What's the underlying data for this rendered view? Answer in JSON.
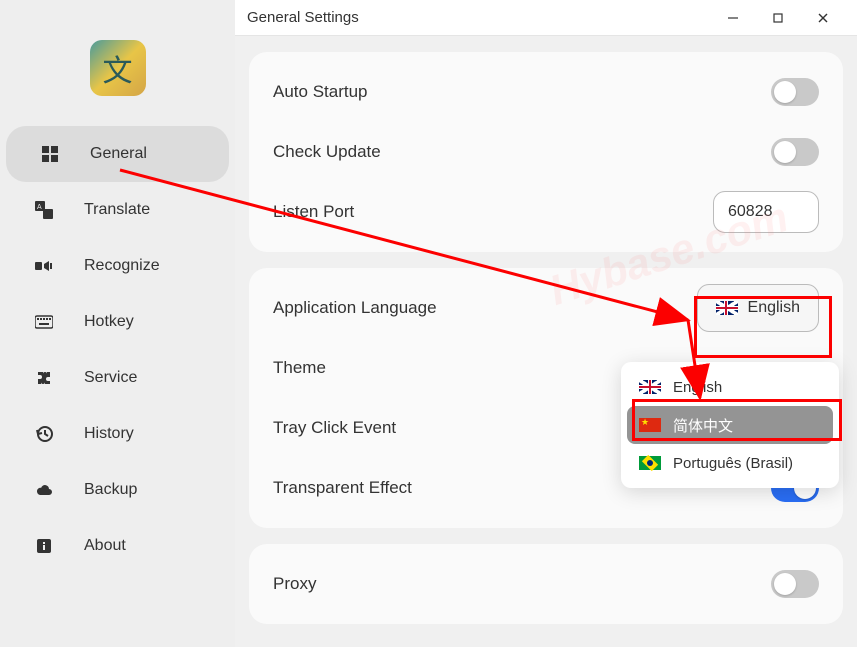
{
  "window": {
    "title": "General Settings"
  },
  "sidebar": {
    "items": [
      {
        "label": "General"
      },
      {
        "label": "Translate"
      },
      {
        "label": "Recognize"
      },
      {
        "label": "Hotkey"
      },
      {
        "label": "Service"
      },
      {
        "label": "History"
      },
      {
        "label": "Backup"
      },
      {
        "label": "About"
      }
    ]
  },
  "settings": {
    "auto_startup": {
      "label": "Auto Startup",
      "value": false
    },
    "check_update": {
      "label": "Check Update",
      "value": false
    },
    "listen_port": {
      "label": "Listen Port",
      "value": "60828"
    },
    "app_language": {
      "label": "Application Language",
      "value": "English"
    },
    "theme": {
      "label": "Theme"
    },
    "tray_click": {
      "label": "Tray Click Event"
    },
    "transparent": {
      "label": "Transparent Effect",
      "value": true
    },
    "proxy": {
      "label": "Proxy",
      "value": false
    }
  },
  "language_dropdown": {
    "options": [
      {
        "label": "English"
      },
      {
        "label": "简体中文"
      },
      {
        "label": "Português (Brasil)"
      }
    ]
  },
  "watermark": "Hybase.com"
}
